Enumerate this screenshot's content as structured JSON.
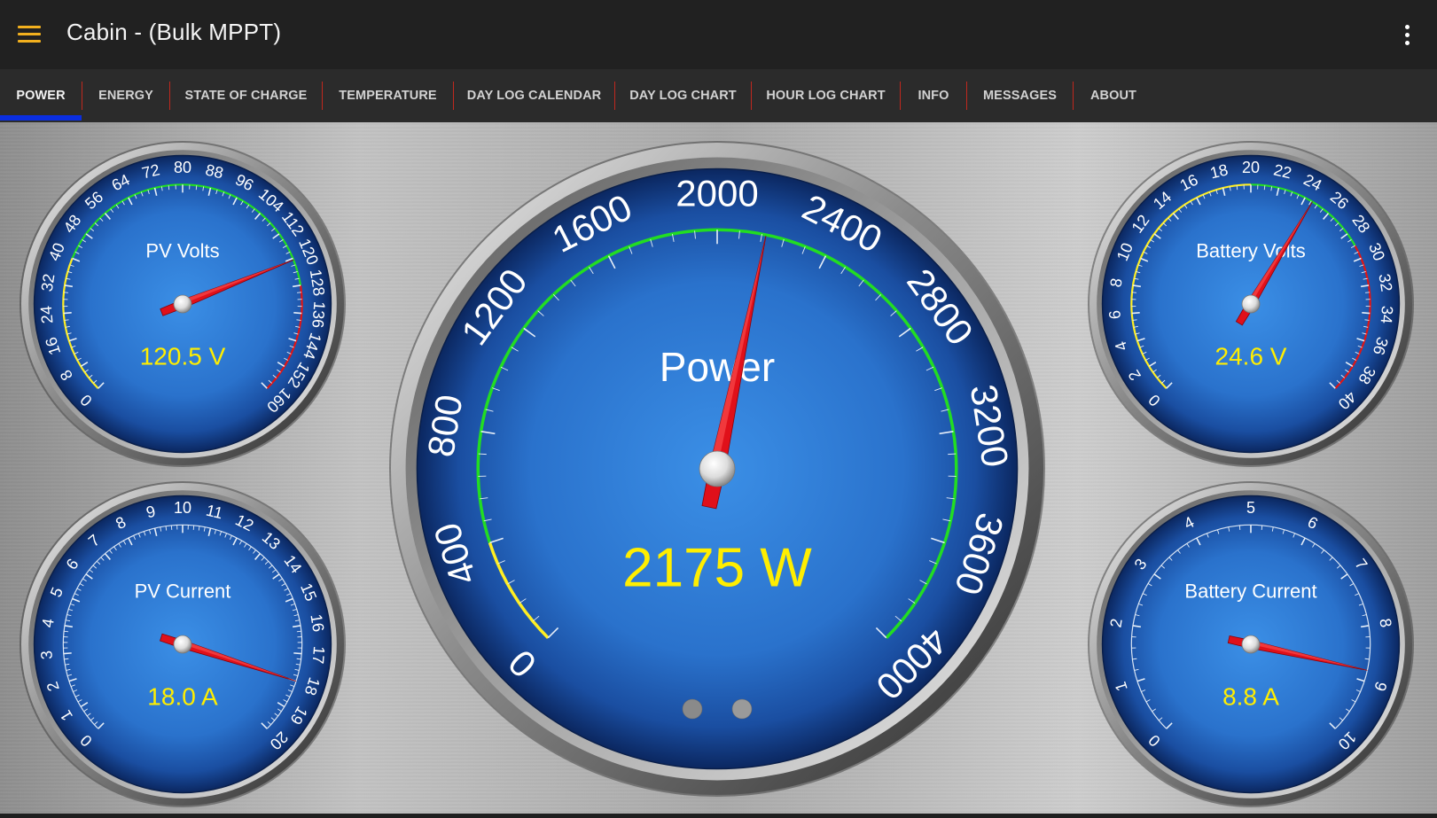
{
  "app": {
    "title": "Cabin - (Bulk MPPT)"
  },
  "tabs": [
    {
      "label": "POWER",
      "active": true
    },
    {
      "label": "ENERGY"
    },
    {
      "label": "STATE OF CHARGE"
    },
    {
      "label": "TEMPERATURE"
    },
    {
      "label": "DAY LOG CALENDAR"
    },
    {
      "label": "DAY LOG CHART"
    },
    {
      "label": "HOUR LOG CHART"
    },
    {
      "label": "INFO"
    },
    {
      "label": "MESSAGES"
    },
    {
      "label": "ABOUT"
    }
  ],
  "icons": {
    "menu": "hamburger-menu-icon",
    "overflow": "more-vert-icon"
  },
  "colors": {
    "accent": "#f2b01e",
    "tab_indicator": "#0a2ee0",
    "tab_divider": "#c0281e",
    "readout": "#ffee00",
    "needle": "#e0101a",
    "green_zone": "#22dd22",
    "yellow_zone": "#ffee22",
    "red_zone": "#e01515"
  },
  "gauges": {
    "pv_volts": {
      "label": "PV Volts",
      "readout": "120.5 V",
      "value": 120.5,
      "min": 0,
      "max": 160,
      "ticks": [
        "0",
        "8",
        "16",
        "24",
        "32",
        "40",
        "48",
        "56",
        "64",
        "72",
        "80",
        "88",
        "96",
        "104",
        "112",
        "120",
        "128",
        "136",
        "144",
        "152",
        "160"
      ],
      "yellow_zone": [
        0,
        40
      ],
      "green_zone": [
        40,
        128
      ],
      "red_zone": [
        128,
        160
      ]
    },
    "pv_current": {
      "label": "PV Current",
      "readout": "18.0 A",
      "value": 18.0,
      "min": 0,
      "max": 20,
      "ticks": [
        "0",
        "1",
        "2",
        "3",
        "4",
        "5",
        "6",
        "7",
        "8",
        "9",
        "10",
        "11",
        "12",
        "13",
        "14",
        "15",
        "16",
        "17",
        "18",
        "19",
        "20"
      ]
    },
    "power": {
      "label": "Power",
      "readout": "2175 W",
      "value": 2175,
      "min": 0,
      "max": 4000,
      "ticks": [
        "0",
        "400",
        "800",
        "1200",
        "1600",
        "2000",
        "2400",
        "2800",
        "3200",
        "3600",
        "4000"
      ],
      "yellow_zone": [
        0,
        400
      ],
      "green_zone": [
        400,
        4000
      ]
    },
    "battery_volts": {
      "label": "Battery Volts",
      "readout": "24.6 V",
      "value": 24.6,
      "min": 0,
      "max": 40,
      "ticks": [
        "0",
        "2",
        "4",
        "6",
        "8",
        "10",
        "12",
        "14",
        "16",
        "18",
        "20",
        "22",
        "24",
        "26",
        "28",
        "30",
        "32",
        "34",
        "36",
        "38",
        "40"
      ],
      "yellow_zone": [
        0,
        20
      ],
      "green_zone": [
        20,
        29
      ],
      "red_zone": [
        29,
        40
      ]
    },
    "battery_current": {
      "label": "Battery Current",
      "readout": "8.8 A",
      "value": 8.8,
      "min": 0,
      "max": 10,
      "ticks": [
        "0",
        "1",
        "2",
        "3",
        "4",
        "5",
        "6",
        "7",
        "8",
        "9",
        "10"
      ]
    }
  },
  "pager": {
    "page_count": 2,
    "current_page": 1
  }
}
